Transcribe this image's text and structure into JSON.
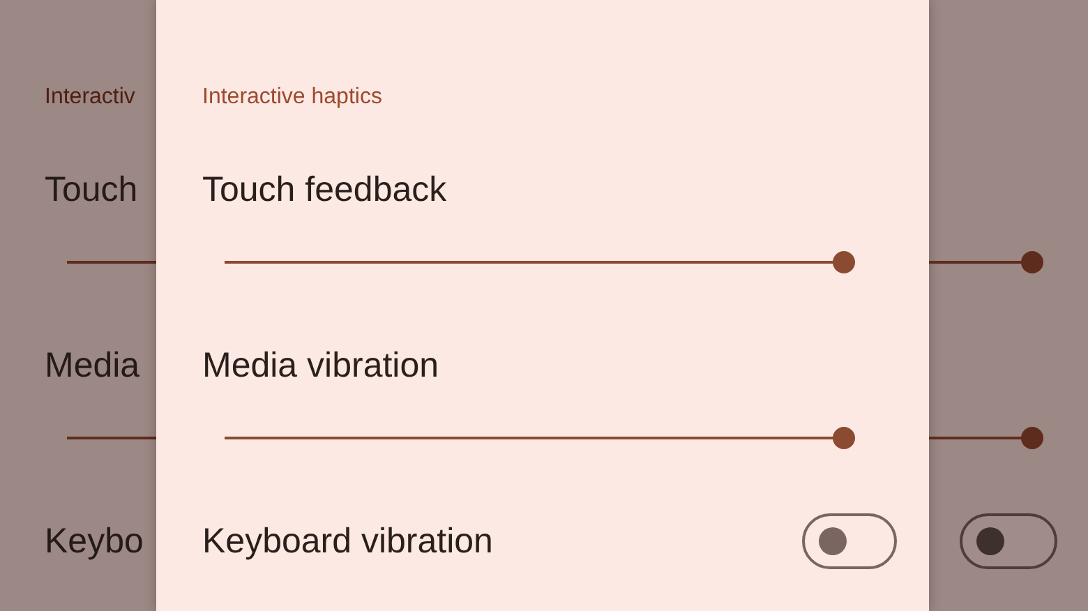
{
  "background": {
    "section_header": "Interactiv",
    "items": [
      {
        "kind": "slider",
        "label": "Touch",
        "level": 1
      },
      {
        "kind": "slider",
        "label": "Media",
        "level": 1
      },
      {
        "kind": "toggle",
        "label": "Keybo",
        "on": false
      }
    ]
  },
  "panel": {
    "section_header": "Interactive haptics",
    "items": [
      {
        "kind": "slider",
        "label": "Touch feedback",
        "level": 1
      },
      {
        "kind": "slider",
        "label": "Media vibration",
        "level": 1
      },
      {
        "kind": "toggle",
        "label": "Keyboard vibration",
        "on": false
      }
    ]
  }
}
